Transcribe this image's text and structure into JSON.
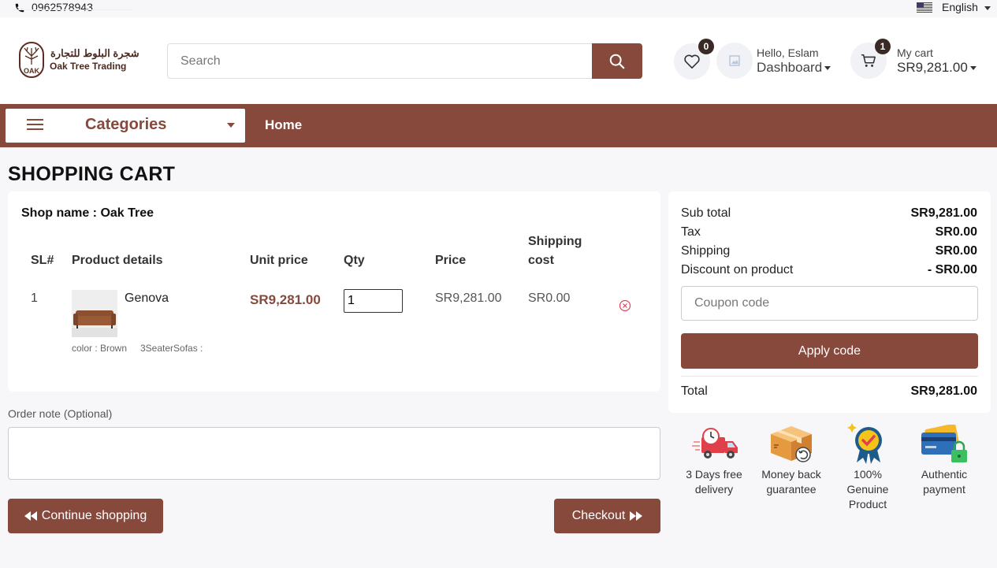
{
  "topbar": {
    "phone": "0962578943",
    "language": "English"
  },
  "header": {
    "logo_ar": "شجرة البلوط للتجارة",
    "logo_en": "Oak Tree Trading",
    "logo_mark": "OAK",
    "search_placeholder": "Search",
    "wishlist_count": "0",
    "greeting": "Hello, Eslam",
    "dashboard_label": "Dashboard",
    "cart_count": "1",
    "cart_label": "My cart",
    "cart_total": "SR9,281.00"
  },
  "nav": {
    "categories_label": "Categories",
    "home_label": "Home"
  },
  "page": {
    "title": "SHOPPING CART"
  },
  "cart": {
    "shop_name": "Shop name : Oak Tree",
    "headers": {
      "sl": "SL#",
      "product": "Product details",
      "unit_price": "Unit price",
      "qty": "Qty",
      "price": "Price",
      "shipping_1": "Shipping",
      "shipping_2": "cost"
    },
    "items": [
      {
        "sl": "1",
        "name": "Genova",
        "unit_price": "SR9,281.00",
        "qty": "1",
        "price": "SR9,281.00",
        "shipping": "SR0.00",
        "variant_color": "color : Brown",
        "variant_type": "3SeaterSofas :"
      }
    ]
  },
  "order_note": {
    "label": "Order note (Optional)"
  },
  "actions": {
    "continue": "Continue shopping",
    "checkout": "Checkout"
  },
  "summary": {
    "subtotal_label": "Sub total",
    "subtotal": "SR9,281.00",
    "tax_label": "Tax",
    "tax": "SR0.00",
    "shipping_label": "Shipping",
    "shipping": "SR0.00",
    "discount_label": "Discount on product",
    "discount": "- SR0.00",
    "coupon_placeholder": "Coupon code",
    "apply_label": "Apply code",
    "total_label": "Total",
    "total": "SR9,281.00"
  },
  "features": [
    {
      "line1": "3 Days free",
      "line2": "delivery",
      "icon": "delivery-truck-icon"
    },
    {
      "line1": "Money back",
      "line2": "guarantee",
      "icon": "money-back-box-icon"
    },
    {
      "line1": "100% Genuine",
      "line2": "Product",
      "icon": "genuine-badge-icon"
    },
    {
      "line1": "Authentic",
      "line2": "payment",
      "icon": "secure-card-icon"
    }
  ],
  "colors": {
    "brand": "#87493c",
    "badge": "#3a2a25"
  }
}
